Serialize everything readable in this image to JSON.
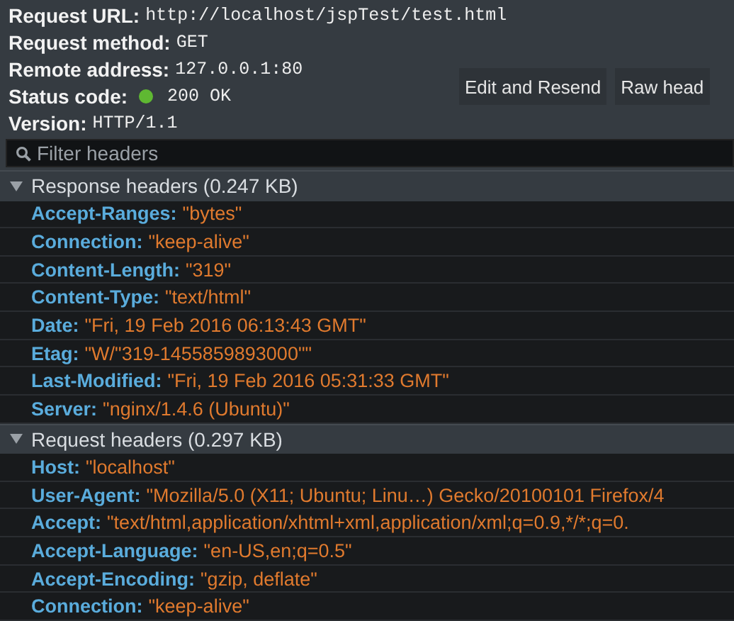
{
  "summary": [
    {
      "label": "Request URL:",
      "value": "http://localhost/jspTest/test.html"
    },
    {
      "label": "Request method:",
      "value": "GET"
    },
    {
      "label": "Remote address:",
      "value": "127.0.0.1:80"
    },
    {
      "label": "Status code:",
      "value": "200 OK",
      "color": "#5fb832"
    },
    {
      "label": "Version:",
      "value": "HTTP/1.1"
    }
  ],
  "buttons": [
    "Edit and Resend",
    "Raw head"
  ],
  "filter": {
    "placeholder": "Filter headers"
  },
  "sections": [
    {
      "title": "Response headers (0.247 KB)",
      "expanded": true,
      "headers": [
        {
          "name": "Accept-Ranges:",
          "value": "\"bytes\""
        },
        {
          "name": "Connection:",
          "value": "\"keep-alive\""
        },
        {
          "name": "Content-Length:",
          "value": "\"319\""
        },
        {
          "name": "Content-Type:",
          "value": "\"text/html\""
        },
        {
          "name": "Date:",
          "value": "\"Fri, 19 Feb 2016 06:13:43 GMT\""
        },
        {
          "name": "Etag:",
          "value": "\"W/\"319-1455859893000\"\""
        },
        {
          "name": "Last-Modified:",
          "value": "\"Fri, 19 Feb 2016 05:31:33 GMT\""
        },
        {
          "name": "Server:",
          "value": "\"nginx/1.4.6 (Ubuntu)\""
        }
      ]
    },
    {
      "title": "Request headers (0.297 KB)",
      "expanded": true,
      "headers": [
        {
          "name": "Host:",
          "value": "\"localhost\""
        },
        {
          "name": "User-Agent:",
          "value": "\"Mozilla/5.0 (X11; Ubuntu; Linu…) Gecko/20100101 Firefox/4"
        },
        {
          "name": "Accept:",
          "value": "\"text/html,application/xhtml+xml,application/xml;q=0.9,*/*;q=0."
        },
        {
          "name": "Accept-Language:",
          "value": "\"en-US,en;q=0.5\""
        },
        {
          "name": "Accept-Encoding:",
          "value": "\"gzip, deflate\""
        },
        {
          "name": "Connection:",
          "value": "\"keep-alive\""
        }
      ]
    }
  ]
}
